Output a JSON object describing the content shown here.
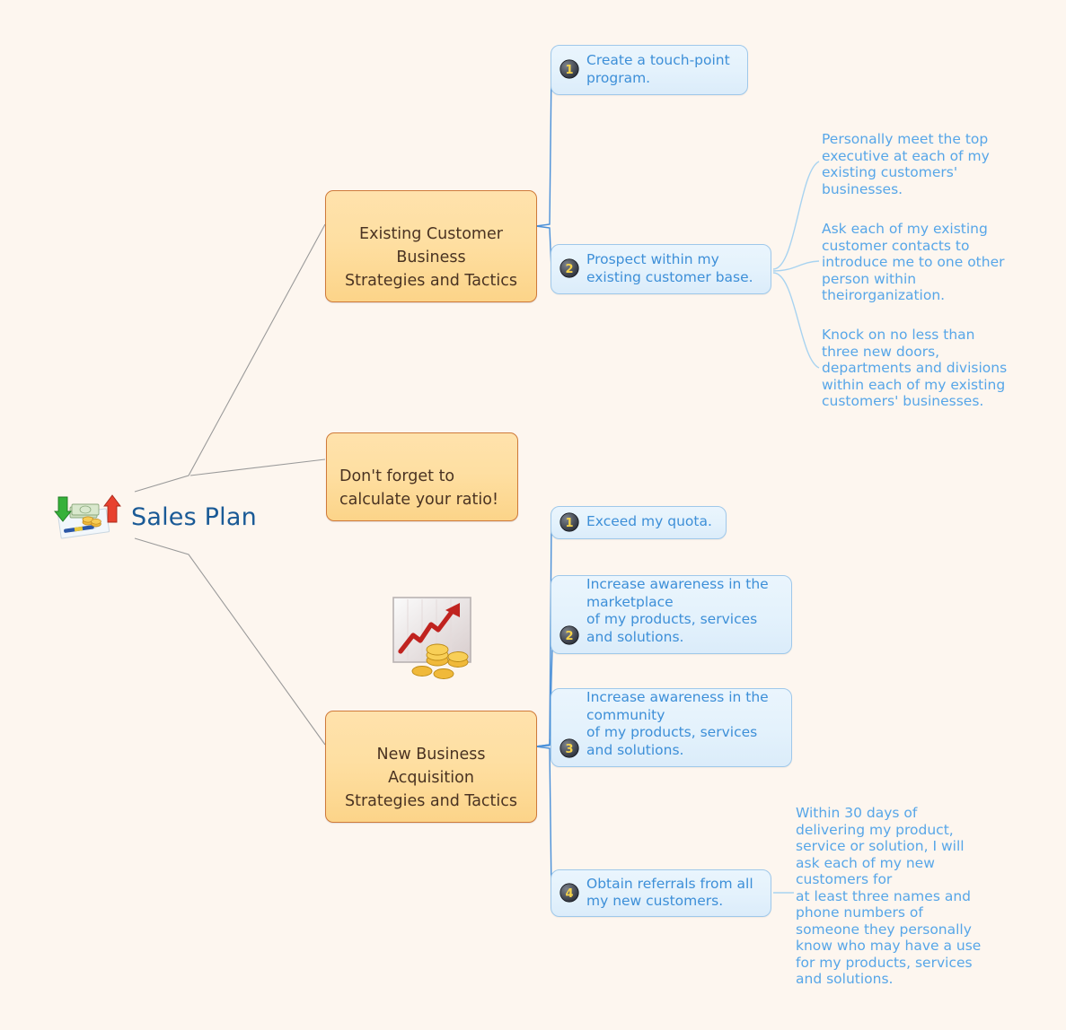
{
  "page": {
    "background_color": "#fdf6ef",
    "title": "Sales Plan"
  },
  "central_topic": {
    "label": "Sales Plan",
    "color": "#1a5a96",
    "icon": "money-chart-arrows-icon"
  },
  "main_topics": [
    {
      "id": "existing-customer-business",
      "label": "Existing Customer\nBusiness\nStrategies and Tactics",
      "fill": "#fedfa2",
      "border": "#cf7a3a",
      "text_color": "#4a3322"
    },
    {
      "id": "new-business-acquisition",
      "label": "New Business\nAcquisition\nStrategies and Tactics",
      "fill": "#fedfa2",
      "border": "#cf7a3a",
      "text_color": "#4a3322"
    }
  ],
  "note_topic": {
    "label": "Don't forget to\ncalculate your ratio!",
    "fill": "#fedfa2",
    "border": "#cf7a3a"
  },
  "sub_topics": [
    {
      "id": "create-touch-point-program",
      "number": "1",
      "text": "Create a touch-point\nprogram.",
      "parent": "existing-customer-business"
    },
    {
      "id": "prospect-within-existing-base",
      "number": "2",
      "text": "Prospect within my\nexisting customer base.",
      "parent": "existing-customer-business"
    },
    {
      "id": "exceed-my-quota",
      "number": "1",
      "text": "Exceed my quota.",
      "parent": "new-business-acquisition"
    },
    {
      "id": "increase-awareness-marketplace",
      "number": "2",
      "text": "Increase awareness in the\nmarketplace\nof my products, services\nand solutions.",
      "parent": "new-business-acquisition"
    },
    {
      "id": "increase-awareness-community",
      "number": "3",
      "text": "Increase awareness in the\ncommunity\nof my products, services\nand solutions.",
      "parent": "new-business-acquisition"
    },
    {
      "id": "obtain-referrals",
      "number": "4",
      "text": "Obtain referrals from all\nmy new customers.",
      "parent": "new-business-acquisition"
    }
  ],
  "floating_texts": [
    {
      "id": "meet-top-executive",
      "text": "Personally meet the top\nexecutive at each of my\nexisting customers'\nbusinesses.",
      "parent": "prospect-within-existing-base"
    },
    {
      "id": "ask-for-introductions",
      "text": "Ask each of my existing\ncustomer contacts to\nintroduce me to one other\nperson within\ntheirorganization.",
      "parent": "prospect-within-existing-base"
    },
    {
      "id": "knock-on-new-doors",
      "text": "Knock on no less than\nthree new doors,\ndepartments and divisions\nwithin each of my existing\ncustomers' businesses.",
      "parent": "prospect-within-existing-base"
    },
    {
      "id": "within-30-days-referrals",
      "text": "Within 30 days of\ndelivering my product,\nservice or solution, I will\nask each of my new\ncustomers for\nat least three names and\nphone numbers of\nsomeone they personally\nknow who may have a use\nfor my products, services\nand solutions.",
      "parent": "obtain-referrals"
    }
  ],
  "decor_icons": [
    {
      "id": "growth-chart-coins",
      "name": "growth-chart-coins-icon"
    }
  ]
}
